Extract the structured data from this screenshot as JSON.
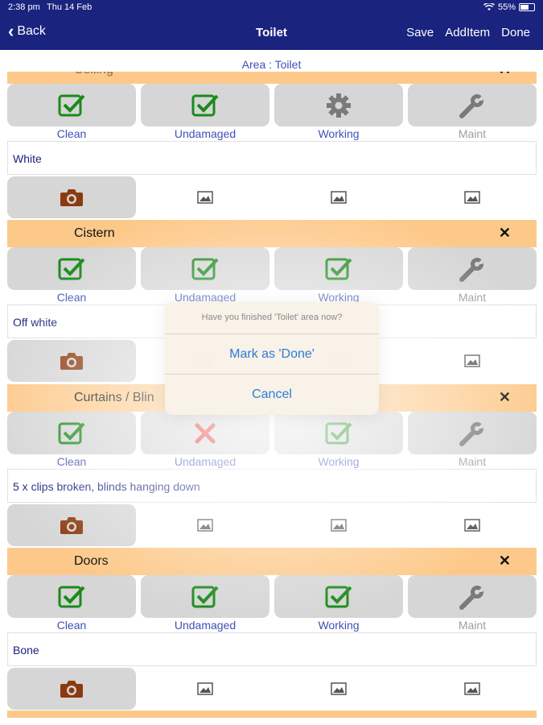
{
  "status": {
    "time": "2:38 pm",
    "date": "Thu 14 Feb",
    "battery": "55%"
  },
  "nav": {
    "back": "Back",
    "title": "Toilet",
    "save": "Save",
    "add_item": "AddItem",
    "done": "Done"
  },
  "area_title": "Area : Toilet",
  "labels": {
    "clean": "Clean",
    "undamaged": "Undamaged",
    "working": "Working",
    "maint": "Maint"
  },
  "sections": [
    {
      "name": "Ceiling",
      "note": "White",
      "clean": "check",
      "undamaged": "check",
      "working": "gear",
      "maint": "wrench"
    },
    {
      "name": "Cistern",
      "note": "Off white",
      "clean": "check",
      "undamaged": "check",
      "working": "check",
      "maint": "wrench"
    },
    {
      "name": "Curtains / Blinds",
      "name_visible": "Curtains / Blin",
      "note": "5 x clips broken, blinds hanging down",
      "clean": "check",
      "undamaged": "cross",
      "working": "check",
      "maint": "wrench"
    },
    {
      "name": "Doors",
      "note": "Bone",
      "clean": "check",
      "undamaged": "check",
      "working": "check",
      "maint": "wrench"
    }
  ],
  "dialog": {
    "message": "Have you finished 'Toilet' area now?",
    "mark_done": "Mark as 'Done'",
    "cancel": "Cancel"
  },
  "colors": {
    "nav": "#1a237e",
    "header": "#fdc98a",
    "tile": "#d6d6d6",
    "check": "#1b8a1b",
    "cross": "#e0201b",
    "camera": "#8b3a0f",
    "link": "#2f7bd6"
  }
}
